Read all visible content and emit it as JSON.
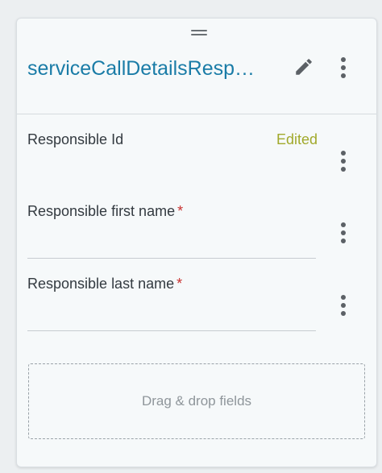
{
  "card": {
    "title": "serviceCallDetailsResp…",
    "edit_icon": "pencil-icon",
    "more_icon": "more-vertical-icon"
  },
  "fields": [
    {
      "label": "Responsible Id",
      "required": false,
      "status": "Edited"
    },
    {
      "label": "Responsible first name",
      "required": true,
      "required_mark": "*"
    },
    {
      "label": "Responsible last name",
      "required": true,
      "required_mark": "*"
    }
  ],
  "dropzone": {
    "text": "Drag & drop fields"
  },
  "colors": {
    "title": "#1a7ca7",
    "edited_status": "#a1a92b",
    "required_mark": "#c8312f"
  }
}
